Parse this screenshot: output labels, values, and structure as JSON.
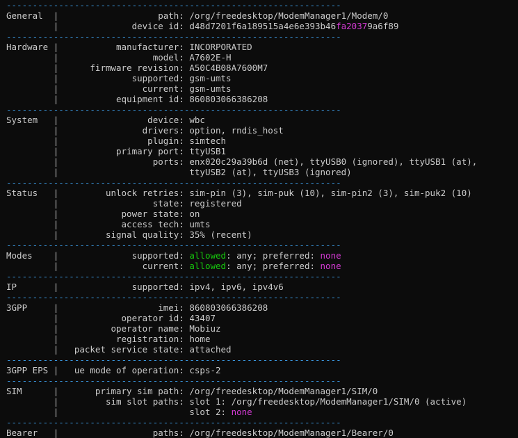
{
  "separator": "----------------------------------------------------------------",
  "sections": [
    {
      "name": "General",
      "rows": [
        {
          "label": "path",
          "segments": [
            {
              "text": "/org/freedesktop/ModemManager1/Modem/0"
            }
          ]
        },
        {
          "label": "device id",
          "segments": [
            {
              "text": "d48d7201f6a189515a4e6e393b46"
            },
            {
              "text": "fa2037",
              "color": "magenta"
            },
            {
              "text": "9a6f89"
            }
          ]
        }
      ]
    },
    {
      "name": "Hardware",
      "rows": [
        {
          "label": "manufacturer",
          "segments": [
            {
              "text": "INCORPORATED"
            }
          ]
        },
        {
          "label": "model",
          "segments": [
            {
              "text": "A7602E-H"
            }
          ]
        },
        {
          "label": "firmware revision",
          "segments": [
            {
              "text": "A50C4B08A7600M7"
            }
          ]
        },
        {
          "label": "supported",
          "segments": [
            {
              "text": "gsm-umts"
            }
          ]
        },
        {
          "label": "current",
          "segments": [
            {
              "text": "gsm-umts"
            }
          ]
        },
        {
          "label": "equipment id",
          "segments": [
            {
              "text": "860803066386208"
            }
          ]
        }
      ]
    },
    {
      "name": "System",
      "rows": [
        {
          "label": "device",
          "segments": [
            {
              "text": "wbc"
            }
          ]
        },
        {
          "label": "drivers",
          "segments": [
            {
              "text": "option, rndis_host"
            }
          ]
        },
        {
          "label": "plugin",
          "segments": [
            {
              "text": "simtech"
            }
          ]
        },
        {
          "label": "primary port",
          "segments": [
            {
              "text": "ttyUSB1"
            }
          ]
        },
        {
          "label": "ports",
          "segments": [
            {
              "text": "enx020c29a39b6d (net), ttyUSB0 (ignored), ttyUSB1 (at),"
            }
          ]
        },
        {
          "label": "",
          "segments": [
            {
              "text": "ttyUSB2 (at), ttyUSB3 (ignored)"
            }
          ]
        }
      ]
    },
    {
      "name": "Status",
      "rows": [
        {
          "label": "unlock retries",
          "segments": [
            {
              "text": "sim-pin (3), sim-puk (10), sim-pin2 (3), sim-puk2 (10)"
            }
          ]
        },
        {
          "label": "state",
          "segments": [
            {
              "text": "registered"
            }
          ]
        },
        {
          "label": "power state",
          "segments": [
            {
              "text": "on"
            }
          ]
        },
        {
          "label": "access tech",
          "segments": [
            {
              "text": "umts"
            }
          ]
        },
        {
          "label": "signal quality",
          "segments": [
            {
              "text": "35% (recent)"
            }
          ]
        }
      ]
    },
    {
      "name": "Modes",
      "rows": [
        {
          "label": "supported",
          "segments": [
            {
              "text": "allowed",
              "color": "green"
            },
            {
              "text": ": any; preferred: "
            },
            {
              "text": "none",
              "color": "magenta"
            }
          ]
        },
        {
          "label": "current",
          "segments": [
            {
              "text": "allowed",
              "color": "green"
            },
            {
              "text": ": any; preferred: "
            },
            {
              "text": "none",
              "color": "magenta"
            }
          ]
        }
      ]
    },
    {
      "name": "IP",
      "rows": [
        {
          "label": "supported",
          "segments": [
            {
              "text": "ipv4, ipv6, ipv4v6"
            }
          ]
        }
      ]
    },
    {
      "name": "3GPP",
      "rows": [
        {
          "label": "imei",
          "segments": [
            {
              "text": "860803066386208"
            }
          ]
        },
        {
          "label": "operator id",
          "segments": [
            {
              "text": "43407"
            }
          ]
        },
        {
          "label": "operator name",
          "segments": [
            {
              "text": "Mobiuz"
            }
          ]
        },
        {
          "label": "registration",
          "segments": [
            {
              "text": "home"
            }
          ]
        },
        {
          "label": "packet service state",
          "segments": [
            {
              "text": "attached"
            }
          ]
        }
      ]
    },
    {
      "name": "3GPP EPS",
      "rows": [
        {
          "label": "ue mode of operation",
          "segments": [
            {
              "text": "csps-2"
            }
          ]
        }
      ]
    },
    {
      "name": "SIM",
      "rows": [
        {
          "label": "primary sim path",
          "segments": [
            {
              "text": "/org/freedesktop/ModemManager1/SIM/0"
            }
          ]
        },
        {
          "label": "sim slot paths",
          "segments": [
            {
              "text": "slot 1: /org/freedesktop/ModemManager1/SIM/0 (active)"
            }
          ]
        },
        {
          "label": "",
          "segments": [
            {
              "text": "slot 2: "
            },
            {
              "text": "none",
              "color": "magenta"
            }
          ]
        }
      ]
    },
    {
      "name": "Bearer",
      "rows": [
        {
          "label": "paths",
          "segments": [
            {
              "text": "/org/freedesktop/ModemManager1/Bearer/0"
            }
          ]
        }
      ]
    }
  ],
  "colors": {
    "background": "#0c0c0c",
    "text": "#cccccc",
    "separator": "#3a96dd",
    "green": "#16c60c",
    "magenta": "#d33ad3"
  }
}
